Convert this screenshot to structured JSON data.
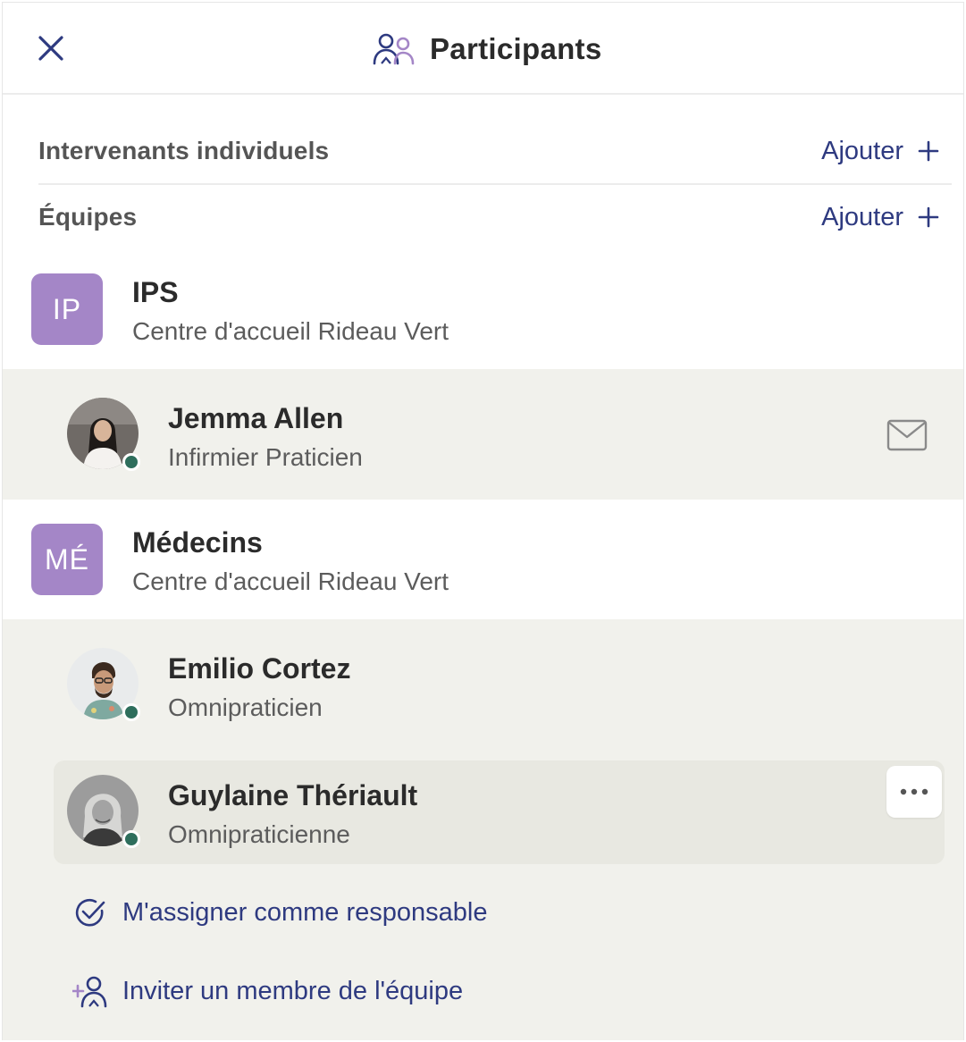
{
  "header": {
    "title": "Participants",
    "close_icon": "close-icon",
    "title_icon": "participants-icon"
  },
  "sections": {
    "individuals": {
      "label": "Intervenants individuels",
      "add_label": "Ajouter"
    },
    "teams": {
      "label": "Équipes",
      "add_label": "Ajouter"
    }
  },
  "teams": [
    {
      "initials": "IP",
      "name": "IPS",
      "org": "Centre d'accueil Rideau Vert",
      "members": [
        {
          "name": "Jemma Allen",
          "role": "Infirmier Praticien",
          "status": "online"
        }
      ]
    },
    {
      "initials": "MÉ",
      "name": "Médecins",
      "org": "Centre d'accueil Rideau Vert",
      "members": [
        {
          "name": "Emilio Cortez",
          "role": "Omnipraticien",
          "status": "online"
        },
        {
          "name": "Guylaine Thériault",
          "role": "Omnipraticienne",
          "status": "online"
        }
      ]
    }
  ],
  "actions": {
    "assign": "M'assigner comme responsable",
    "invite": "Inviter un membre de l'équipe"
  },
  "colors": {
    "accent": "#2e3a80",
    "badge": "#a486c7",
    "member_bg": "#f1f1ec",
    "status_online": "#2e6e5c"
  }
}
